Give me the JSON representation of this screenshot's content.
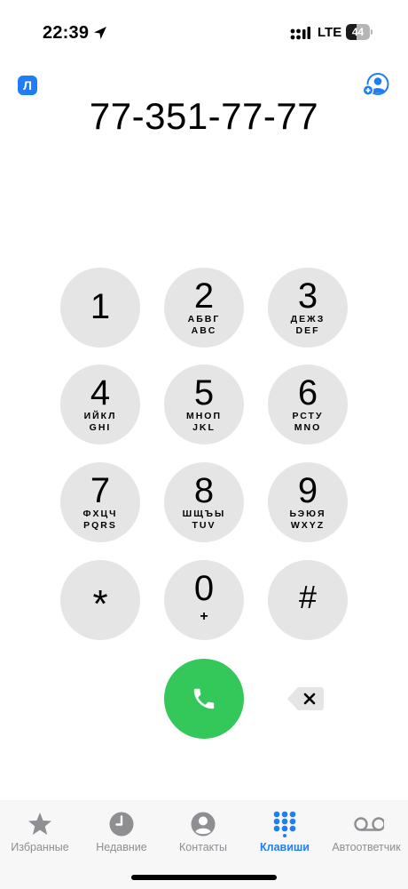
{
  "status_bar": {
    "time": "22:39",
    "network": "LTE",
    "battery_level": "44",
    "battery_fraction": 0.44
  },
  "header": {
    "lang_badge": "Л",
    "add_contact_icon": "person-plus-icon"
  },
  "dialed_number": "77-351-77-77",
  "keypad": {
    "keys": [
      {
        "digit": "1",
        "line1": "",
        "line2": ""
      },
      {
        "digit": "2",
        "line1": "АБВГ",
        "line2": "ABC"
      },
      {
        "digit": "3",
        "line1": "ДЕЖЗ",
        "line2": "DEF"
      },
      {
        "digit": "4",
        "line1": "ИЙКЛ",
        "line2": "GHI"
      },
      {
        "digit": "5",
        "line1": "МНОП",
        "line2": "JKL"
      },
      {
        "digit": "6",
        "line1": "РСТУ",
        "line2": "MNO"
      },
      {
        "digit": "7",
        "line1": "ФХЦЧ",
        "line2": "PQRS"
      },
      {
        "digit": "8",
        "line1": "ШЩЪЫ",
        "line2": "TUV"
      },
      {
        "digit": "9",
        "line1": "ЬЭЮЯ",
        "line2": "WXYZ"
      },
      {
        "digit": "*",
        "line1": "",
        "line2": ""
      },
      {
        "digit": "0",
        "line1": "+",
        "line2": ""
      },
      {
        "digit": "#",
        "line1": "",
        "line2": ""
      }
    ]
  },
  "actions": {
    "call_icon": "phone-icon",
    "delete_icon": "delete-backspace-icon"
  },
  "tabs": [
    {
      "label": "Избранные",
      "icon": "star-icon",
      "active": false
    },
    {
      "label": "Недавние",
      "icon": "clock-icon",
      "active": false
    },
    {
      "label": "Контакты",
      "icon": "person-circle-icon",
      "active": false
    },
    {
      "label": "Клавиши",
      "icon": "keypad-icon",
      "active": true
    },
    {
      "label": "Автоответчик",
      "icon": "voicemail-icon",
      "active": false
    }
  ],
  "colors": {
    "accent": "#1f7ef5",
    "call_green": "#34c85a",
    "key_background": "#e5e5e5",
    "tab_inactive": "#8e8e93"
  }
}
